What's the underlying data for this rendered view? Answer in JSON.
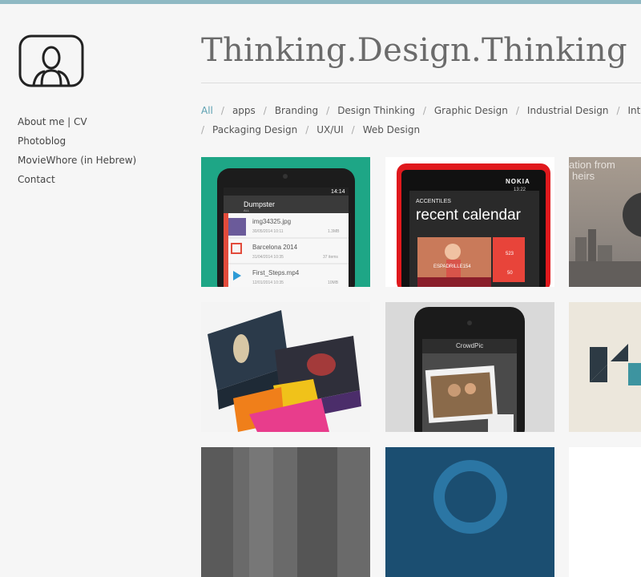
{
  "site": {
    "title": "Thinking.Design.Thinking"
  },
  "nav": {
    "items": [
      {
        "label": "About me | CV"
      },
      {
        "label": "Photoblog"
      },
      {
        "label": "MovieWhore (in Hebrew)"
      },
      {
        "label": "Contact"
      }
    ]
  },
  "filters": {
    "items": [
      {
        "label": "All"
      },
      {
        "label": "apps"
      },
      {
        "label": "Branding"
      },
      {
        "label": "Design Thinking"
      },
      {
        "label": "Graphic Design"
      },
      {
        "label": "Industrial Design"
      },
      {
        "label": "Interaction De"
      },
      {
        "label": "Packaging Design"
      },
      {
        "label": "UX/UI"
      },
      {
        "label": "Web Design"
      }
    ]
  },
  "tiles": {
    "t1": {
      "app": "Dumpster",
      "sub": "ALL",
      "time": "14:14",
      "rows": [
        {
          "name": "img34325.jpg",
          "date": "30/05/2014 10:11",
          "size": "1.3MB"
        },
        {
          "name": "Barcelona 2014",
          "date": "31/04/2014 10:35",
          "size": "37 items"
        },
        {
          "name": "First_Steps.mp4",
          "date": "12/01/2014 10:35",
          "size": "10MB"
        }
      ]
    },
    "t2": {
      "brand": "NOKIA",
      "time": "13:22",
      "acc": "ACCENTILES",
      "headline": "recent calendar",
      "user": "ESPADRILLE154",
      "c1": "523",
      "c2": "50"
    },
    "t3": {
      "text1": "ation from",
      "text2": "heirs"
    },
    "t5": {
      "app": "CrowdPic"
    }
  },
  "colors": {
    "accent": "#5a9fb0",
    "topbar": "#8fb9c3"
  }
}
